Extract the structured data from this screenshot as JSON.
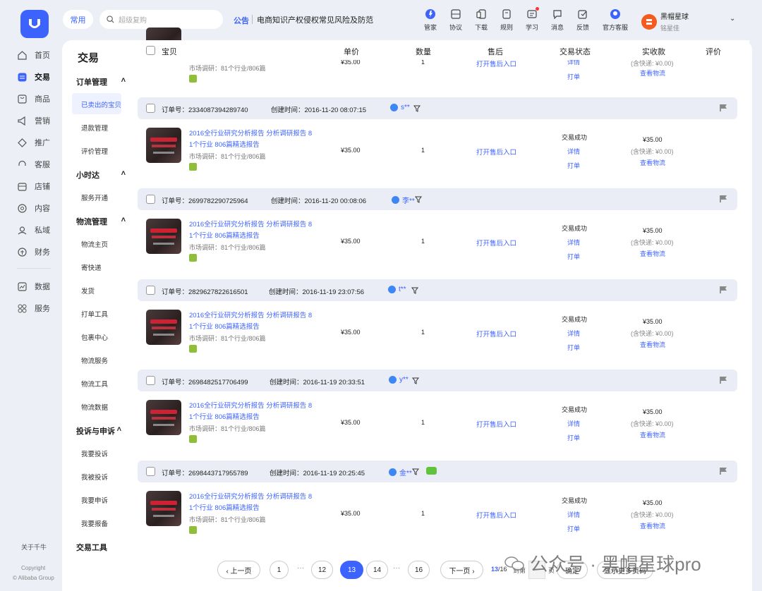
{
  "top": {
    "common": "常用",
    "search_placeholder": "超级复购",
    "notice_tag": "公告",
    "notice_text": "电商知识产权侵权常见风险及防范",
    "icons": [
      {
        "label": "管家",
        "icon": "butler-icon"
      },
      {
        "label": "协议",
        "icon": "agreement-icon"
      },
      {
        "label": "下载",
        "icon": "download-icon"
      },
      {
        "label": "规则",
        "icon": "rules-icon"
      },
      {
        "label": "学习",
        "icon": "learn-icon"
      },
      {
        "label": "消息",
        "icon": "message-icon"
      },
      {
        "label": "反馈",
        "icon": "feedback-icon"
      },
      {
        "label": "官方客服",
        "icon": "service-icon"
      }
    ],
    "user_name": "黑帽星球",
    "user_sub": "铭星佳"
  },
  "nav": [
    {
      "label": "首页",
      "icon": "home-icon"
    },
    {
      "label": "交易",
      "icon": "trade-icon"
    },
    {
      "label": "商品",
      "icon": "goods-icon"
    },
    {
      "label": "营销",
      "icon": "marketing-icon"
    },
    {
      "label": "推广",
      "icon": "promote-icon"
    },
    {
      "label": "客服",
      "icon": "cs-icon"
    },
    {
      "label": "店铺",
      "icon": "shop-icon"
    },
    {
      "label": "内容",
      "icon": "content-icon"
    },
    {
      "label": "私域",
      "icon": "private-icon"
    },
    {
      "label": "财务",
      "icon": "finance-icon"
    },
    {
      "label": "数据",
      "icon": "data-icon"
    },
    {
      "label": "服务",
      "icon": "service-grid-icon"
    }
  ],
  "nav_footer": {
    "about": "关于千牛",
    "copyright1": "Copyright",
    "copyright2": "© Alibaba Group"
  },
  "subnav": {
    "title": "交易",
    "g1": "订单管理",
    "g1_items": [
      "已卖出的宝贝",
      "退款管理",
      "评价管理"
    ],
    "g2": "小时达",
    "g2_items": [
      "服务开通"
    ],
    "g3": "物流管理",
    "g3_items": [
      "物流主页",
      "寄快递",
      "发货",
      "打单工具",
      "包裹中心",
      "物流服务",
      "物流工具",
      "物流数据"
    ],
    "g4": "投诉与申诉",
    "g4_items": [
      "我要投诉",
      "我被投诉",
      "我要申诉",
      "我要报备"
    ],
    "g5": "交易工具"
  },
  "table_header": {
    "item": "宝贝",
    "price": "单价",
    "qty": "数量",
    "after": "售后",
    "status": "交易状态",
    "paid": "实收款",
    "review": "评价"
  },
  "product": {
    "title": "2016全行业研究分析报告 分析调研报告 8 1个行业 806篇精选报告",
    "sub": "市场调研：81个行业/806篇",
    "price": "¥35.00",
    "qty": "1",
    "after_sale": "打开售后入口",
    "status": "交易成功",
    "detail": "详情",
    "print": "打单",
    "amount": "¥35.00",
    "shipping": "(含快递: ¥0.00)",
    "logistics": "查看物流"
  },
  "top_partial": {
    "sub": "市场调研：81个行业/806篇",
    "price": "¥35.00",
    "qty": "1",
    "after_sale": "打开售后入口",
    "detail": "详情",
    "print": "打单",
    "shipping": "(含快递: ¥0.00)",
    "logistics": "查看物流"
  },
  "labels": {
    "order_no": "订单号：",
    "created": "创建时间："
  },
  "orders": [
    {
      "no": "2334087394289740",
      "time": "2016-11-20 08:07:15",
      "buyer": "s**"
    },
    {
      "no": "2699782290725964",
      "time": "2016-11-20 00:08:06",
      "buyer": "李**"
    },
    {
      "no": "2829627822616501",
      "time": "2016-11-19 23:07:56",
      "buyer": "t**"
    },
    {
      "no": "2698482517706499",
      "time": "2016-11-19 20:33:51",
      "buyer": "y**"
    },
    {
      "no": "2698443717955789",
      "time": "2016-11-19 20:25:45",
      "buyer": "金**"
    }
  ],
  "pager": {
    "prev": "‹ 上一页",
    "p1": "1",
    "p12": "12",
    "p13": "13",
    "p14": "14",
    "p16": "16",
    "next": "下一页 ›",
    "count_cur": "13",
    "count_total": "/16",
    "goto": "到第",
    "unit": "页",
    "confirm": "确定",
    "more": "显示更多页码",
    "ellipsis": "···"
  },
  "watermark": "公众号 · 黑帽星球pro"
}
